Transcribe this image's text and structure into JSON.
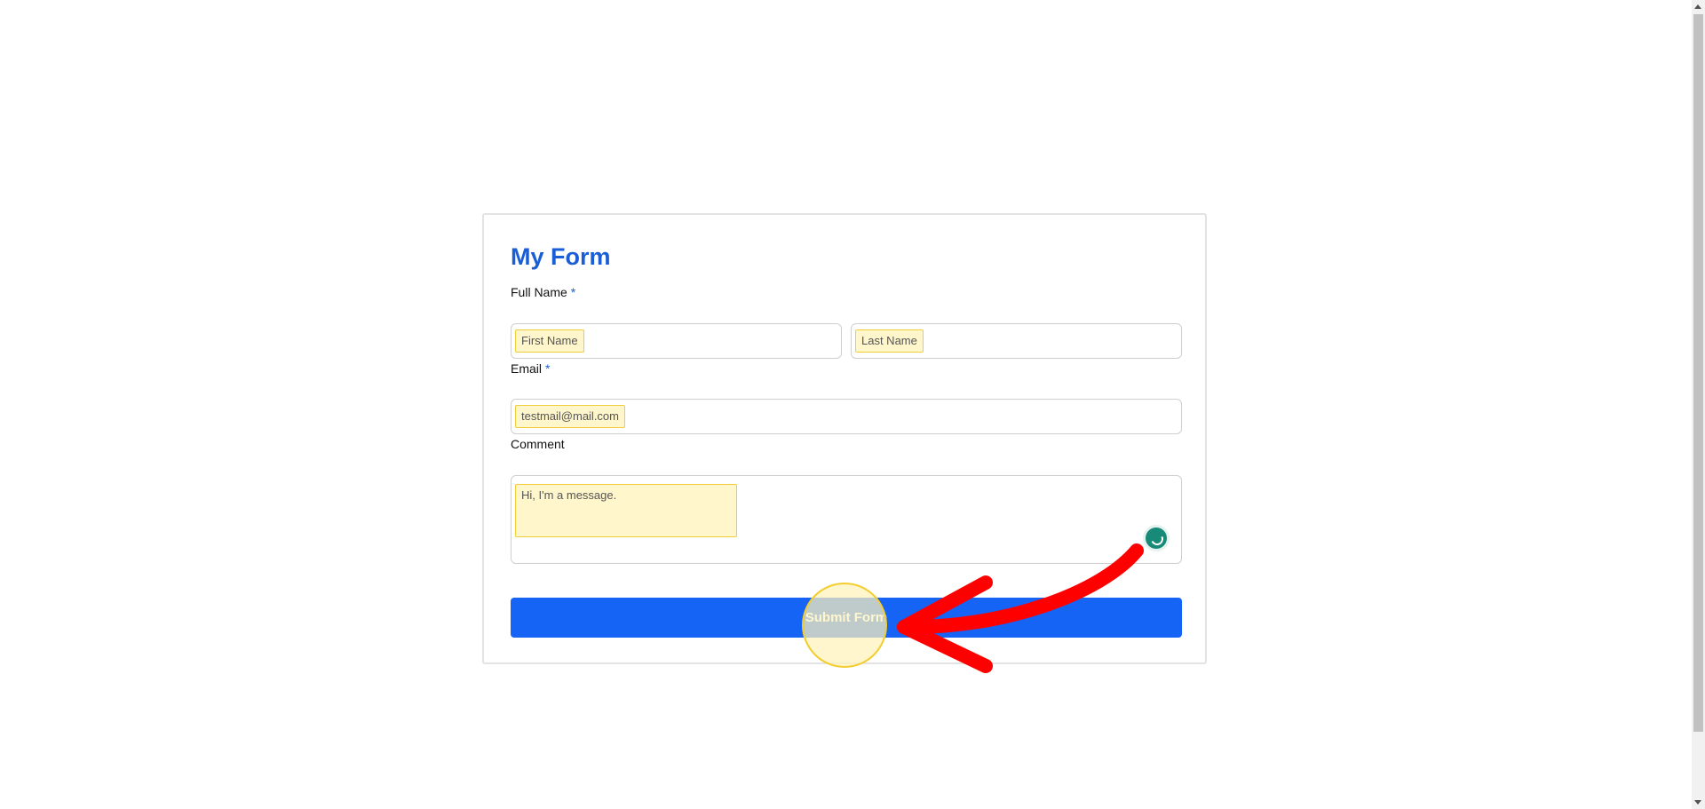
{
  "form": {
    "title": "My Form",
    "full_name": {
      "label": "Full Name",
      "required_mark": "*",
      "first_placeholder": "First Name",
      "last_placeholder": "Last Name"
    },
    "email": {
      "label": "Email",
      "required_mark": "*",
      "value": "testmail@mail.com"
    },
    "comment": {
      "label": "Comment",
      "value": "Hi, I'm a message."
    },
    "submit_label": "Submit Form"
  },
  "colors": {
    "accent": "#1664f5",
    "title": "#1a5ed6",
    "highlight_fill": "#fff6cc",
    "highlight_border": "#f1cd3a",
    "annotation_arrow": "#ff0000",
    "grammar_icon": "#178a78"
  },
  "icons": {
    "grammar_check": "grammarly-style-icon",
    "annotation": "red-curved-arrow-icon"
  }
}
